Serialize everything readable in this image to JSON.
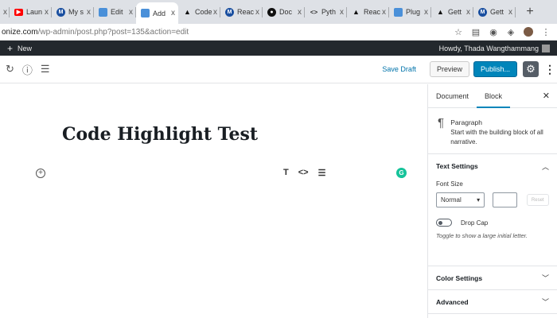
{
  "browser": {
    "tabs": [
      {
        "label": "",
        "favicon": "none",
        "close": "x"
      },
      {
        "label": "Laun",
        "favicon": "yt",
        "close": "x"
      },
      {
        "label": "My s",
        "favicon": "m",
        "close": "x"
      },
      {
        "label": "Edit",
        "favicon": "wp",
        "close": "x"
      },
      {
        "label": "Add",
        "favicon": "wp",
        "close": "x",
        "active": true
      },
      {
        "label": "Code",
        "favicon": "tri",
        "close": "x"
      },
      {
        "label": "Reac",
        "favicon": "m",
        "close": "x"
      },
      {
        "label": "Doc",
        "favicon": "gh",
        "close": "x"
      },
      {
        "label": "Pyth",
        "favicon": "code",
        "close": "x"
      },
      {
        "label": "Reac",
        "favicon": "tri",
        "close": "x"
      },
      {
        "label": "Plug",
        "favicon": "wp",
        "close": "x"
      },
      {
        "label": "Gett",
        "favicon": "tri",
        "close": "x"
      },
      {
        "label": "Gett",
        "favicon": "m",
        "close": "x"
      }
    ],
    "new_tab": "+",
    "url_host": "onize.com",
    "url_path": "/wp-admin/post.php?post=135&action=edit"
  },
  "adminbar": {
    "new_label": "New",
    "howdy": "Howdy, Thada Wangthammang"
  },
  "header": {
    "save_draft": "Save Draft",
    "preview": "Preview",
    "publish": "Publish..."
  },
  "editor": {
    "post_title": "Code Highlight Test"
  },
  "sidebar": {
    "tab_document": "Document",
    "tab_block": "Block",
    "block_name": "Paragraph",
    "block_desc": "Start with the building block of all narrative.",
    "text_settings": "Text Settings",
    "font_size_label": "Font Size",
    "font_size_value": "Normal",
    "reset": "Reset",
    "drop_cap": "Drop Cap",
    "drop_cap_help": "Toggle to show a large initial letter.",
    "color_settings": "Color Settings",
    "advanced": "Advanced"
  },
  "colors": {
    "accent": "#0085ba",
    "admin_bar": "#23282d",
    "link": "#0073aa"
  }
}
